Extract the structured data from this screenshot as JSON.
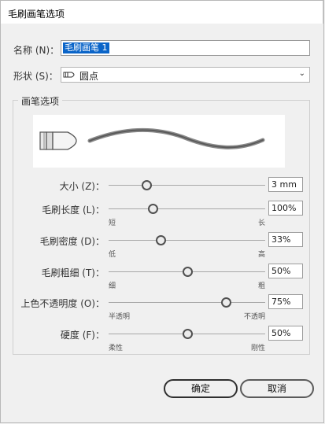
{
  "dialog": {
    "title": "毛刷画笔选项"
  },
  "name_field": {
    "label": "名称 (N)：",
    "value": "毛刷画笔 1"
  },
  "shape_field": {
    "label": "形状 (S)：",
    "value": "圆点",
    "icon": "round-point-brush-icon"
  },
  "brush_options": {
    "group_title": "画笔选项",
    "sliders": [
      {
        "label": "大小 (Z)：",
        "value": "3 mm",
        "level": 0.24,
        "min_label": "",
        "max_label": ""
      },
      {
        "label": "毛刷长度 (L)：",
        "value": "100%",
        "level": 0.28,
        "min_label": "短",
        "max_label": "长"
      },
      {
        "label": "毛刷密度 (D)：",
        "value": "33%",
        "level": 0.33,
        "min_label": "低",
        "max_label": "高"
      },
      {
        "label": "毛刷粗细 (T)：",
        "value": "50%",
        "level": 0.5,
        "min_label": "细",
        "max_label": "粗"
      },
      {
        "label": "上色不透明度 (O)：",
        "value": "75%",
        "level": 0.75,
        "min_label": "半透明",
        "max_label": "不透明"
      },
      {
        "label": "硬度 (F)：",
        "value": "50%",
        "level": 0.5,
        "min_label": "柔性",
        "max_label": "刚性"
      }
    ]
  },
  "buttons": {
    "ok": "确定",
    "cancel": "取消"
  },
  "colors": {
    "selection": "#0a64c8",
    "background": "#f0f0f0"
  }
}
